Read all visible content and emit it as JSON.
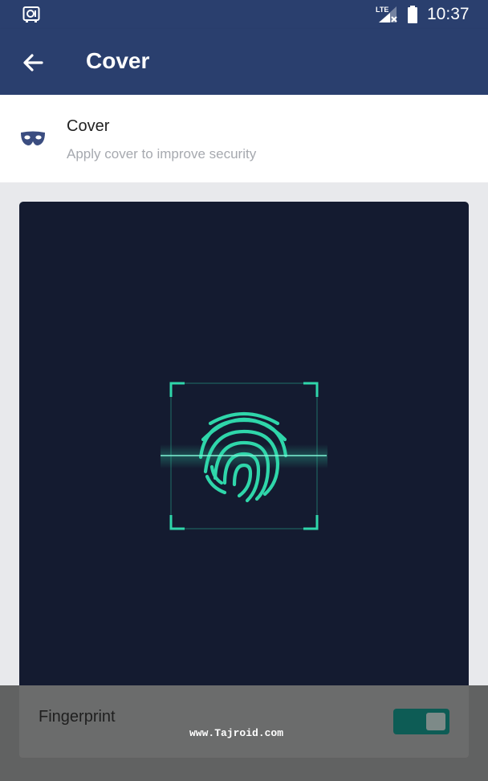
{
  "status_bar": {
    "time": "10:37",
    "icons": [
      "vault-icon",
      "lte-signal-icon",
      "battery-icon"
    ]
  },
  "app_bar": {
    "title": "Cover",
    "back_icon": "arrow-left-icon"
  },
  "cover_setting": {
    "icon": "mask-icon",
    "title": "Cover",
    "subtitle": "Apply cover to improve security"
  },
  "preview": {
    "icon": "fingerprint-scan-icon"
  },
  "fingerprint_option": {
    "label": "Fingerprint",
    "enabled": true
  },
  "watermark": "www.Tajroid.com",
  "colors": {
    "app_bar": "#2a3f6e",
    "preview_bg": "#141b30",
    "accent": "#2fd6aa",
    "toggle_on": "#0d5c55"
  }
}
